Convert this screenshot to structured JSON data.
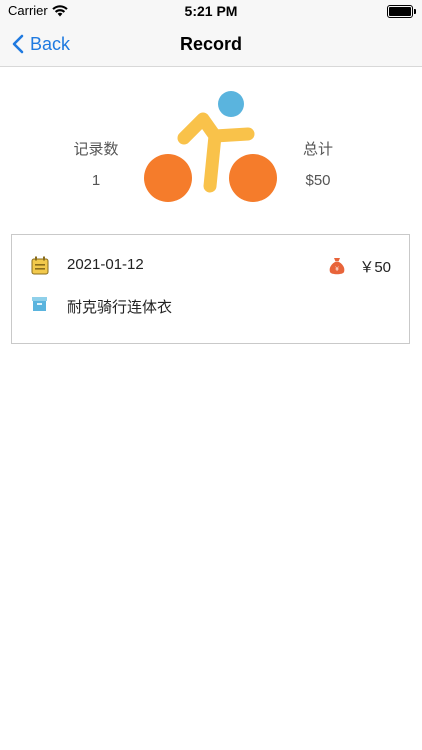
{
  "status_bar": {
    "carrier": "Carrier",
    "time": "5:21 PM"
  },
  "nav": {
    "back_label": "Back",
    "title": "Record"
  },
  "summary": {
    "records_label": "记录数",
    "records_value": "1",
    "total_label": "总计",
    "total_value": "$50"
  },
  "record": {
    "date": "2021-01-12",
    "price": "￥50",
    "item_name": "耐克骑行连体衣"
  },
  "colors": {
    "accent": "#1f7ae0",
    "wheel": "#f57c2b",
    "rider": "#f9c24a",
    "head": "#5ab4de",
    "calendar": "#f2c94c",
    "money": "#e8643a",
    "box": "#5ab4de"
  },
  "icons": [
    "wifi-icon",
    "battery-icon",
    "back-chevron-icon",
    "cyclist-icon",
    "calendar-icon",
    "money-bag-icon",
    "box-icon"
  ]
}
